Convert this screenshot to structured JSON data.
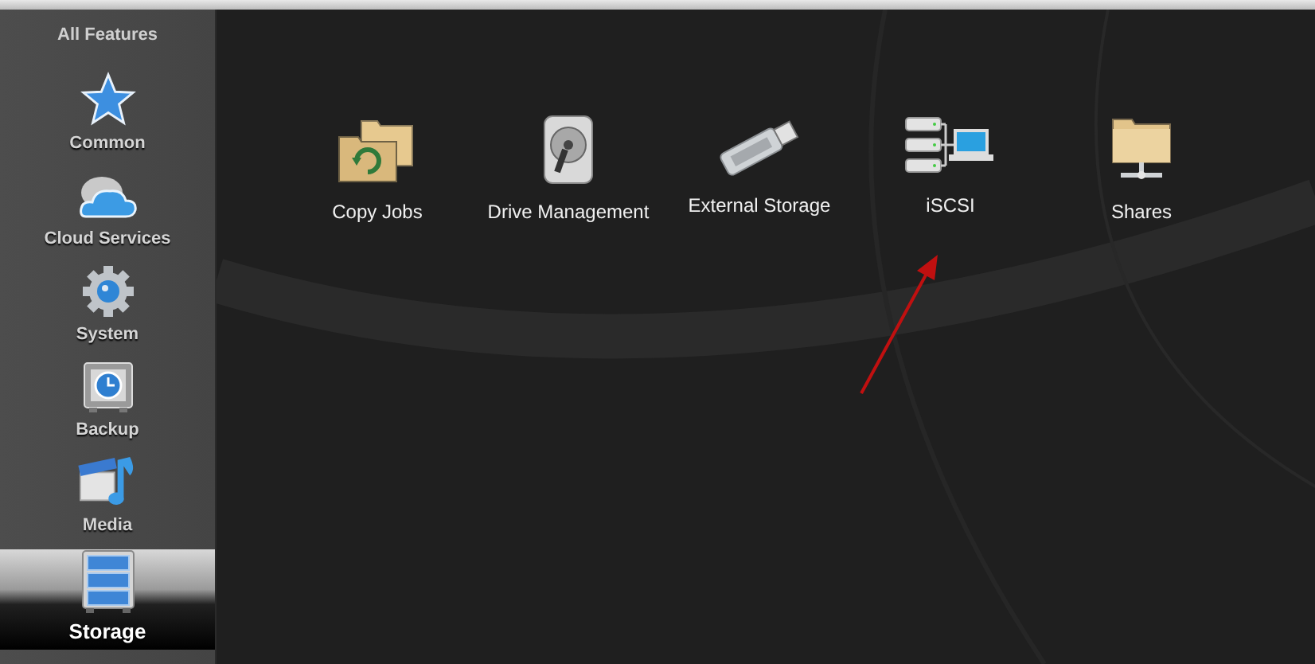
{
  "sidebar": {
    "title": "All Features",
    "items": [
      {
        "label": "Common",
        "kind": "star",
        "selected": false
      },
      {
        "label": "Cloud Services",
        "kind": "cloud",
        "selected": false
      },
      {
        "label": "System",
        "kind": "gear",
        "selected": false
      },
      {
        "label": "Backup",
        "kind": "safe",
        "selected": false
      },
      {
        "label": "Media",
        "kind": "media",
        "selected": false
      },
      {
        "label": "Storage",
        "kind": "storage",
        "selected": true
      }
    ]
  },
  "features": [
    {
      "label": "Copy Jobs",
      "kind": "folders"
    },
    {
      "label": "Drive Management",
      "kind": "disk"
    },
    {
      "label": "External Storage",
      "kind": "usb"
    },
    {
      "label": "iSCSI",
      "kind": "network"
    },
    {
      "label": "Shares",
      "kind": "share"
    }
  ]
}
